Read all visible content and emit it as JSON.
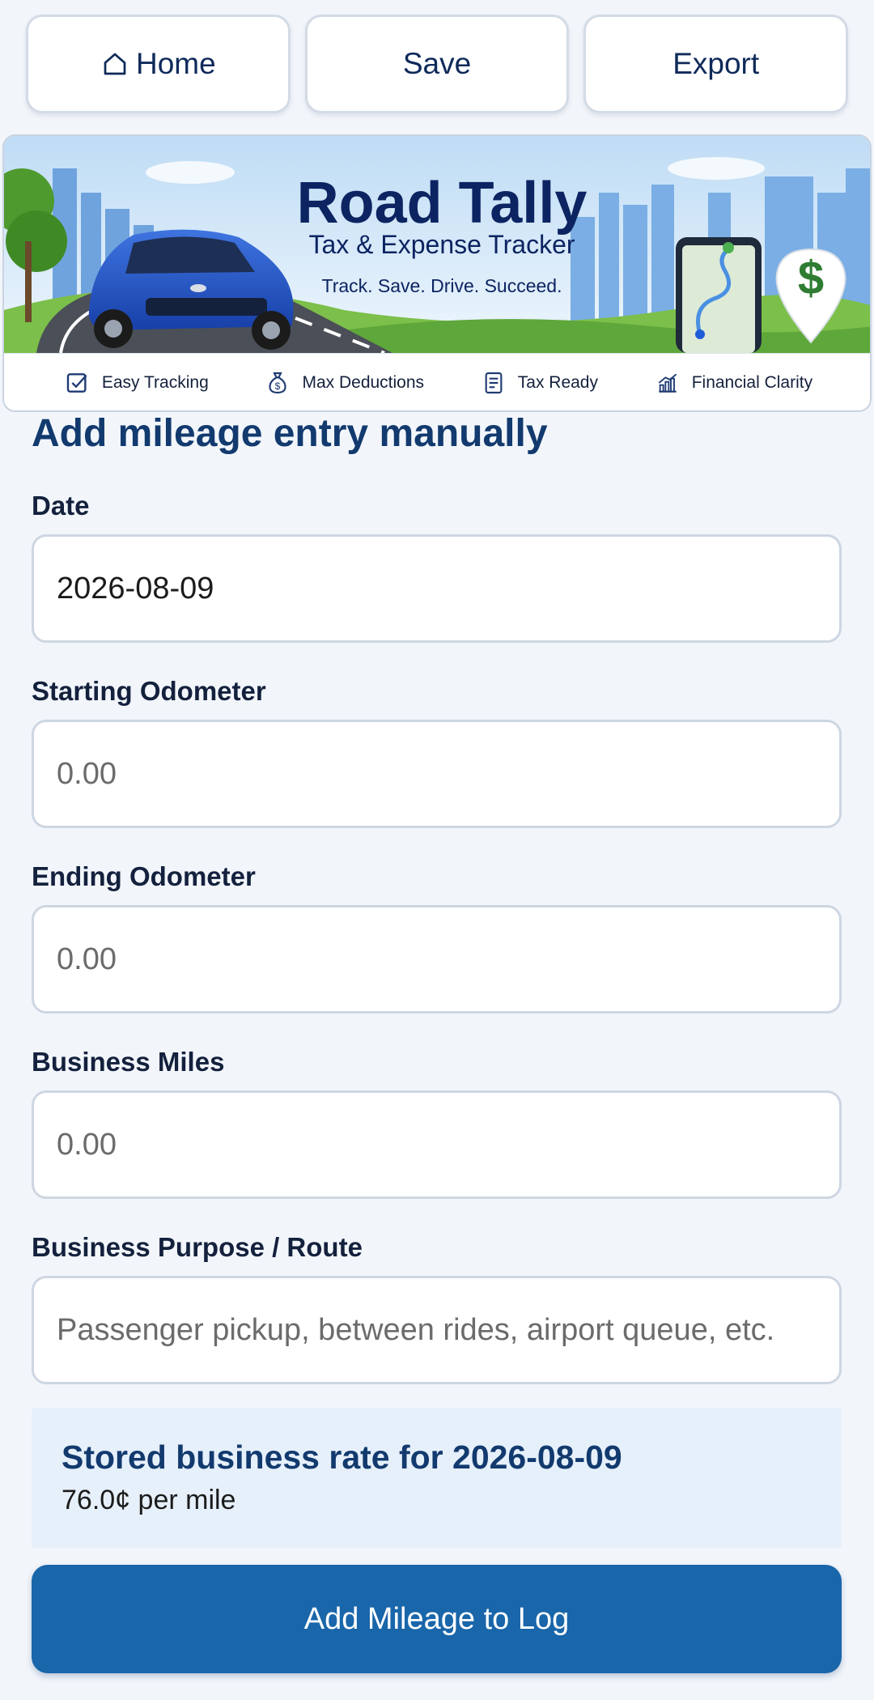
{
  "nav": {
    "home_label": "Home",
    "save_label": "Save",
    "export_label": "Export"
  },
  "banner": {
    "title": "Road Tally",
    "subtitle": "Tax & Expense Tracker",
    "tagline": "Track. Save. Drive. Succeed.",
    "features": [
      {
        "label": "Easy Tracking",
        "icon": "checkbox-icon"
      },
      {
        "label": "Max Deductions",
        "icon": "money-bag-icon"
      },
      {
        "label": "Tax Ready",
        "icon": "document-icon"
      },
      {
        "label": "Financial Clarity",
        "icon": "growth-chart-icon"
      }
    ],
    "pin_symbol": "$"
  },
  "form": {
    "title": "Add mileage entry manually",
    "date_label": "Date",
    "date_value": "2026-08-09",
    "start_label": "Starting Odometer",
    "start_placeholder": "0.00",
    "end_label": "Ending Odometer",
    "end_placeholder": "0.00",
    "miles_label": "Business Miles",
    "miles_placeholder": "0.00",
    "purpose_label": "Business Purpose / Route",
    "purpose_placeholder": "Passenger pickup, between rides, airport queue, etc."
  },
  "rate": {
    "title": "Stored business rate for 2026-08-09",
    "value": "76.0¢ per mile"
  },
  "submit_label": "Add Mileage to Log",
  "colors": {
    "accent": "#1966aa",
    "heading": "#123a6e",
    "brand_navy": "#0c2461",
    "pin_green": "#2e7d32"
  }
}
